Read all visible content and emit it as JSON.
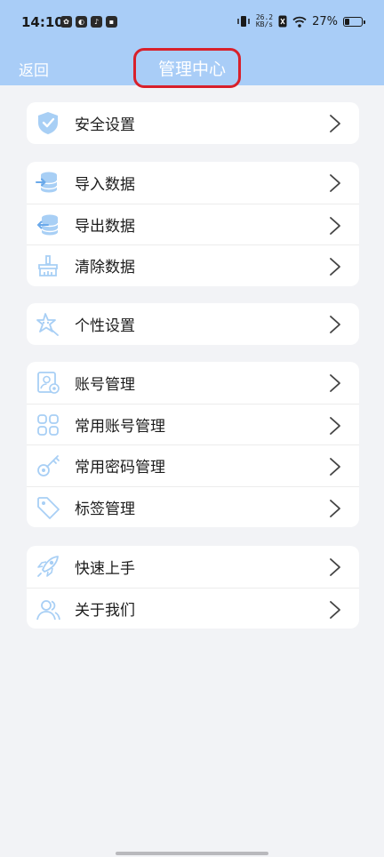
{
  "status": {
    "time": "14:10",
    "network_speed": "26.2",
    "network_unit": "KB/s",
    "battery_percent": "27%",
    "battery_level": 0.27
  },
  "header": {
    "back_label": "返回",
    "title": "管理中心",
    "bg_color": "#a9cdf7",
    "highlight_color": "#d8202b"
  },
  "icon_color": "#a8cff5",
  "groups": [
    {
      "items": [
        {
          "label": "安全设置",
          "icon": "shield-icon"
        }
      ]
    },
    {
      "items": [
        {
          "label": "导入数据",
          "icon": "database-import-icon"
        },
        {
          "label": "导出数据",
          "icon": "database-export-icon"
        },
        {
          "label": "清除数据",
          "icon": "broom-icon"
        }
      ]
    },
    {
      "items": [
        {
          "label": "个性设置",
          "icon": "star-icon"
        }
      ]
    },
    {
      "items": [
        {
          "label": "账号管理",
          "icon": "account-card-icon"
        },
        {
          "label": "常用账号管理",
          "icon": "grid-icon"
        },
        {
          "label": "常用密码管理",
          "icon": "key-icon"
        },
        {
          "label": "标签管理",
          "icon": "tag-icon"
        }
      ]
    },
    {
      "items": [
        {
          "label": "快速上手",
          "icon": "rocket-icon"
        },
        {
          "label": "关于我们",
          "icon": "users-icon"
        }
      ]
    }
  ]
}
